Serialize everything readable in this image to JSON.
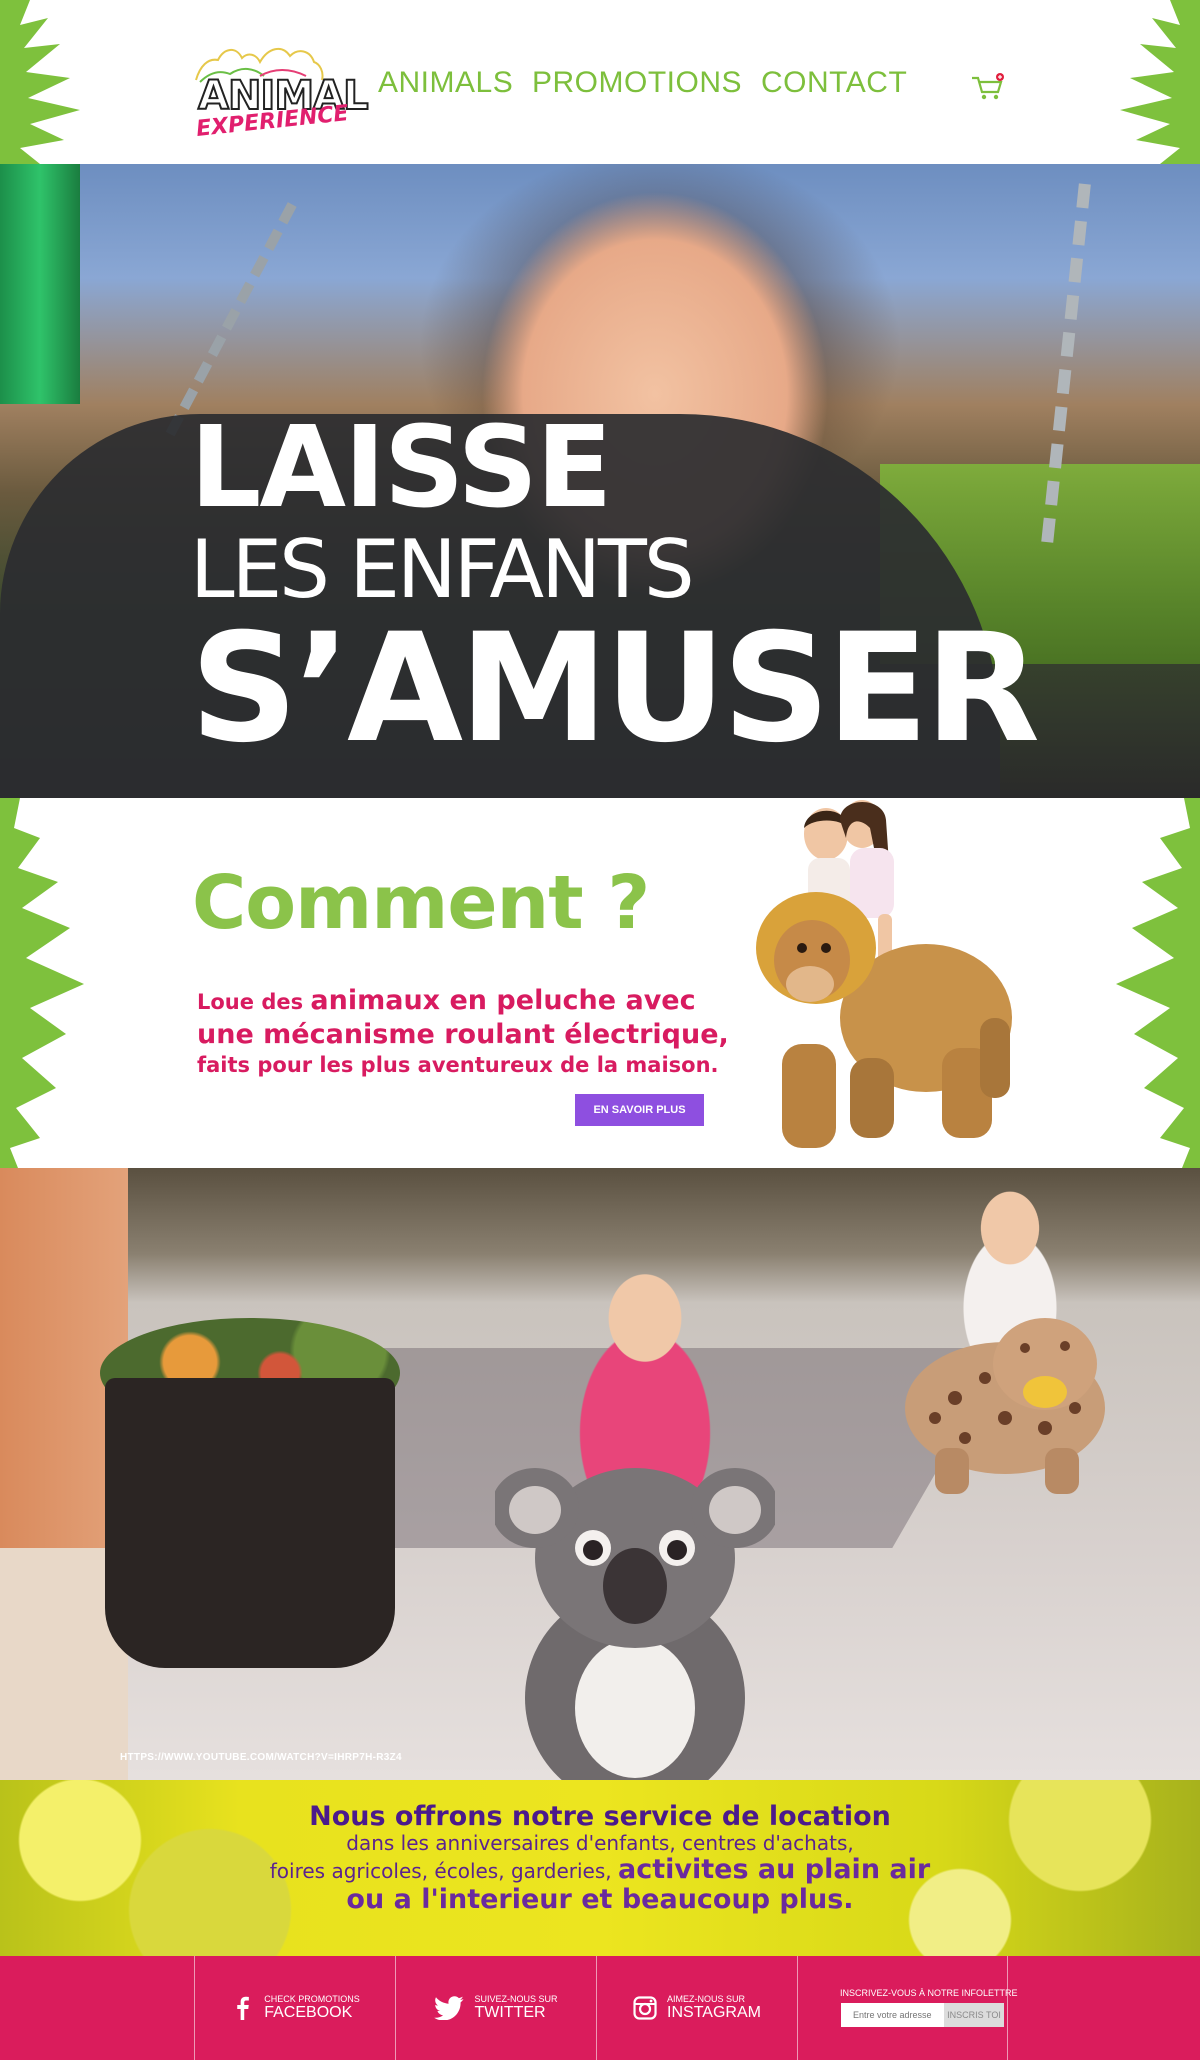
{
  "header": {
    "logo": {
      "line1": "ANIMAL",
      "line2": "EXPERIENCE"
    },
    "nav": [
      {
        "label": "ANIMALS"
      },
      {
        "label": "PROMOTIONS"
      },
      {
        "label": "CONTACT"
      }
    ],
    "cart_icon": "shopping-cart-icon"
  },
  "hero": {
    "line1": "LAISSE",
    "line2": "LES ENFANTS",
    "line3": "S’AMUSER"
  },
  "comment": {
    "title": "Comment ?",
    "text_part1": "Loue des ",
    "text_part2": "animaux en peluche avec",
    "text_part3": "une mécanisme roulant électrique,",
    "text_part4": "faits pour les plus aventureux de la maison.",
    "button_label": "EN SAVOIR PLUS"
  },
  "video": {
    "url": "HTTPS://WWW.YOUTUBE.COM/WATCH?V=IHRP7H-R3Z4"
  },
  "service": {
    "line1": "Nous offrons notre service de location",
    "line2": "dans les anniversaires d'enfants, centres d'achats,",
    "line3_a": "foires agricoles, écoles, garderies, ",
    "line3_b": "activites au plain air",
    "line4": "ou a l'interieur et beaucoup plus."
  },
  "footer": {
    "facebook": {
      "small": "CHECK PROMOTIONS",
      "big": "FACEBOOK",
      "icon": "facebook-icon"
    },
    "twitter": {
      "small": "SUIVEZ-NOUS SUR",
      "big": "TWITTER",
      "icon": "twitter-icon"
    },
    "instagram": {
      "small": "AIMEZ-NOUS SUR",
      "big": "INSTAGRAM",
      "icon": "instagram-icon"
    },
    "newsletter": {
      "label": "INSCRIVEZ-VOUS À NOTRE INFOLETTRE",
      "placeholder": "Entre votre adresse",
      "button_label": "INSCRIS TOI"
    }
  },
  "colors": {
    "nav_green": "#7dbf3c",
    "accent_pink": "#da1c5c",
    "button_purple": "#8e4fe0",
    "service_purple": "#4b1a8c"
  }
}
